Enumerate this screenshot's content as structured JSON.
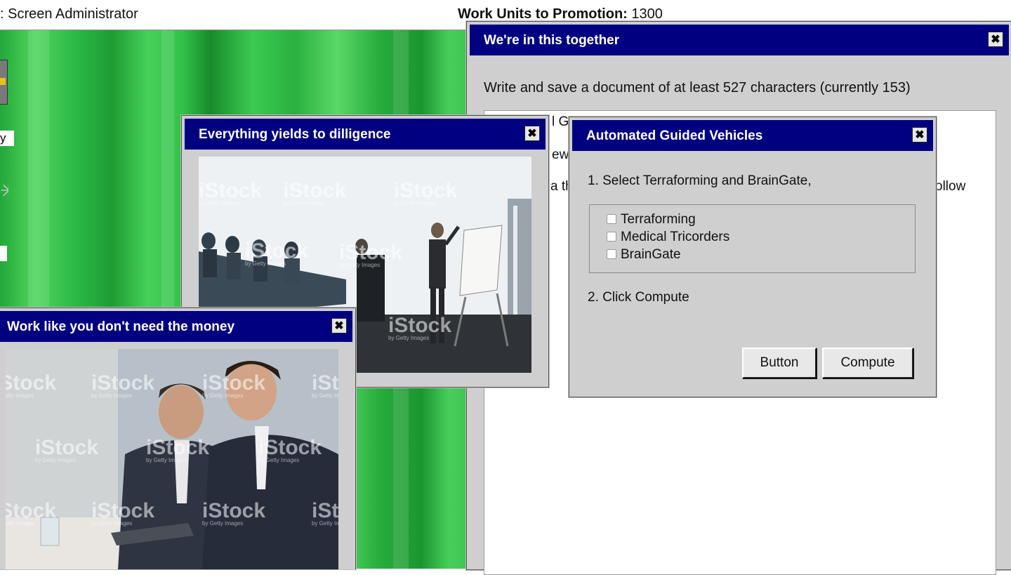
{
  "topbar": {
    "title": ": Screen Administrator",
    "units_label": "Work Units to Promotion:",
    "units_value": "1300"
  },
  "desktop": {
    "label_fragment": "y"
  },
  "windows": {
    "together": {
      "title": "We're in this together",
      "description": "Write and save a document of at least 527 characters (currently 153)",
      "doc_fragments": [
        "l G",
        "ew",
        "a th",
        "ollow"
      ]
    },
    "dilligence": {
      "title": "Everything yields to dilligence",
      "watermark": "iStock",
      "watermark_sub": "by Getty Images"
    },
    "money": {
      "title": "Work like you don't need the money",
      "watermark": "iStock",
      "watermark_sub": "by Getty Images"
    },
    "agv": {
      "title": "Automated Guided Vehicles",
      "step1": "1. Select Terraforming and BrainGate,",
      "options": [
        {
          "label": "Terraforming",
          "checked": false
        },
        {
          "label": "Medical Tricorders",
          "checked": false
        },
        {
          "label": "BrainGate",
          "checked": false
        }
      ],
      "step2": "2. Click Compute",
      "button_label": "Button",
      "compute_label": "Compute"
    }
  },
  "close_glyph": "✖",
  "colors": {
    "titlebar": "#010080",
    "window_bg": "#cfcfcf",
    "desktop_green": "#2ab240"
  }
}
